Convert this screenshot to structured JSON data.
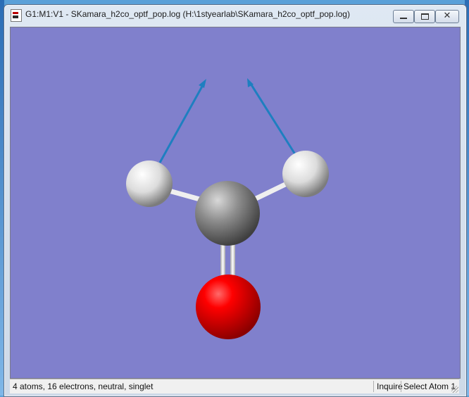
{
  "window": {
    "title": "G1:M1:V1 - SKamara_h2co_optf_pop.log (H:\\1styearlab\\SKamara_h2co_optf_pop.log)",
    "controls": {
      "close_glyph": "✕"
    }
  },
  "viewport": {
    "background_color": "#8080cc",
    "molecule": "formaldehyde",
    "atoms": [
      {
        "element": "H",
        "color": "#e8e8e8"
      },
      {
        "element": "H",
        "color": "#e8e8e8"
      },
      {
        "element": "C",
        "color": "#808080"
      },
      {
        "element": "O",
        "color": "#ff0000"
      }
    ],
    "bonds": [
      "C-H",
      "C-H",
      "C=O"
    ],
    "vectors": {
      "color": "#1e7fc0",
      "count": 2
    }
  },
  "statusbar": {
    "summary": "4 atoms, 16 electrons, neutral, singlet",
    "mode": "Inquire",
    "action": "Select Atom 1"
  }
}
